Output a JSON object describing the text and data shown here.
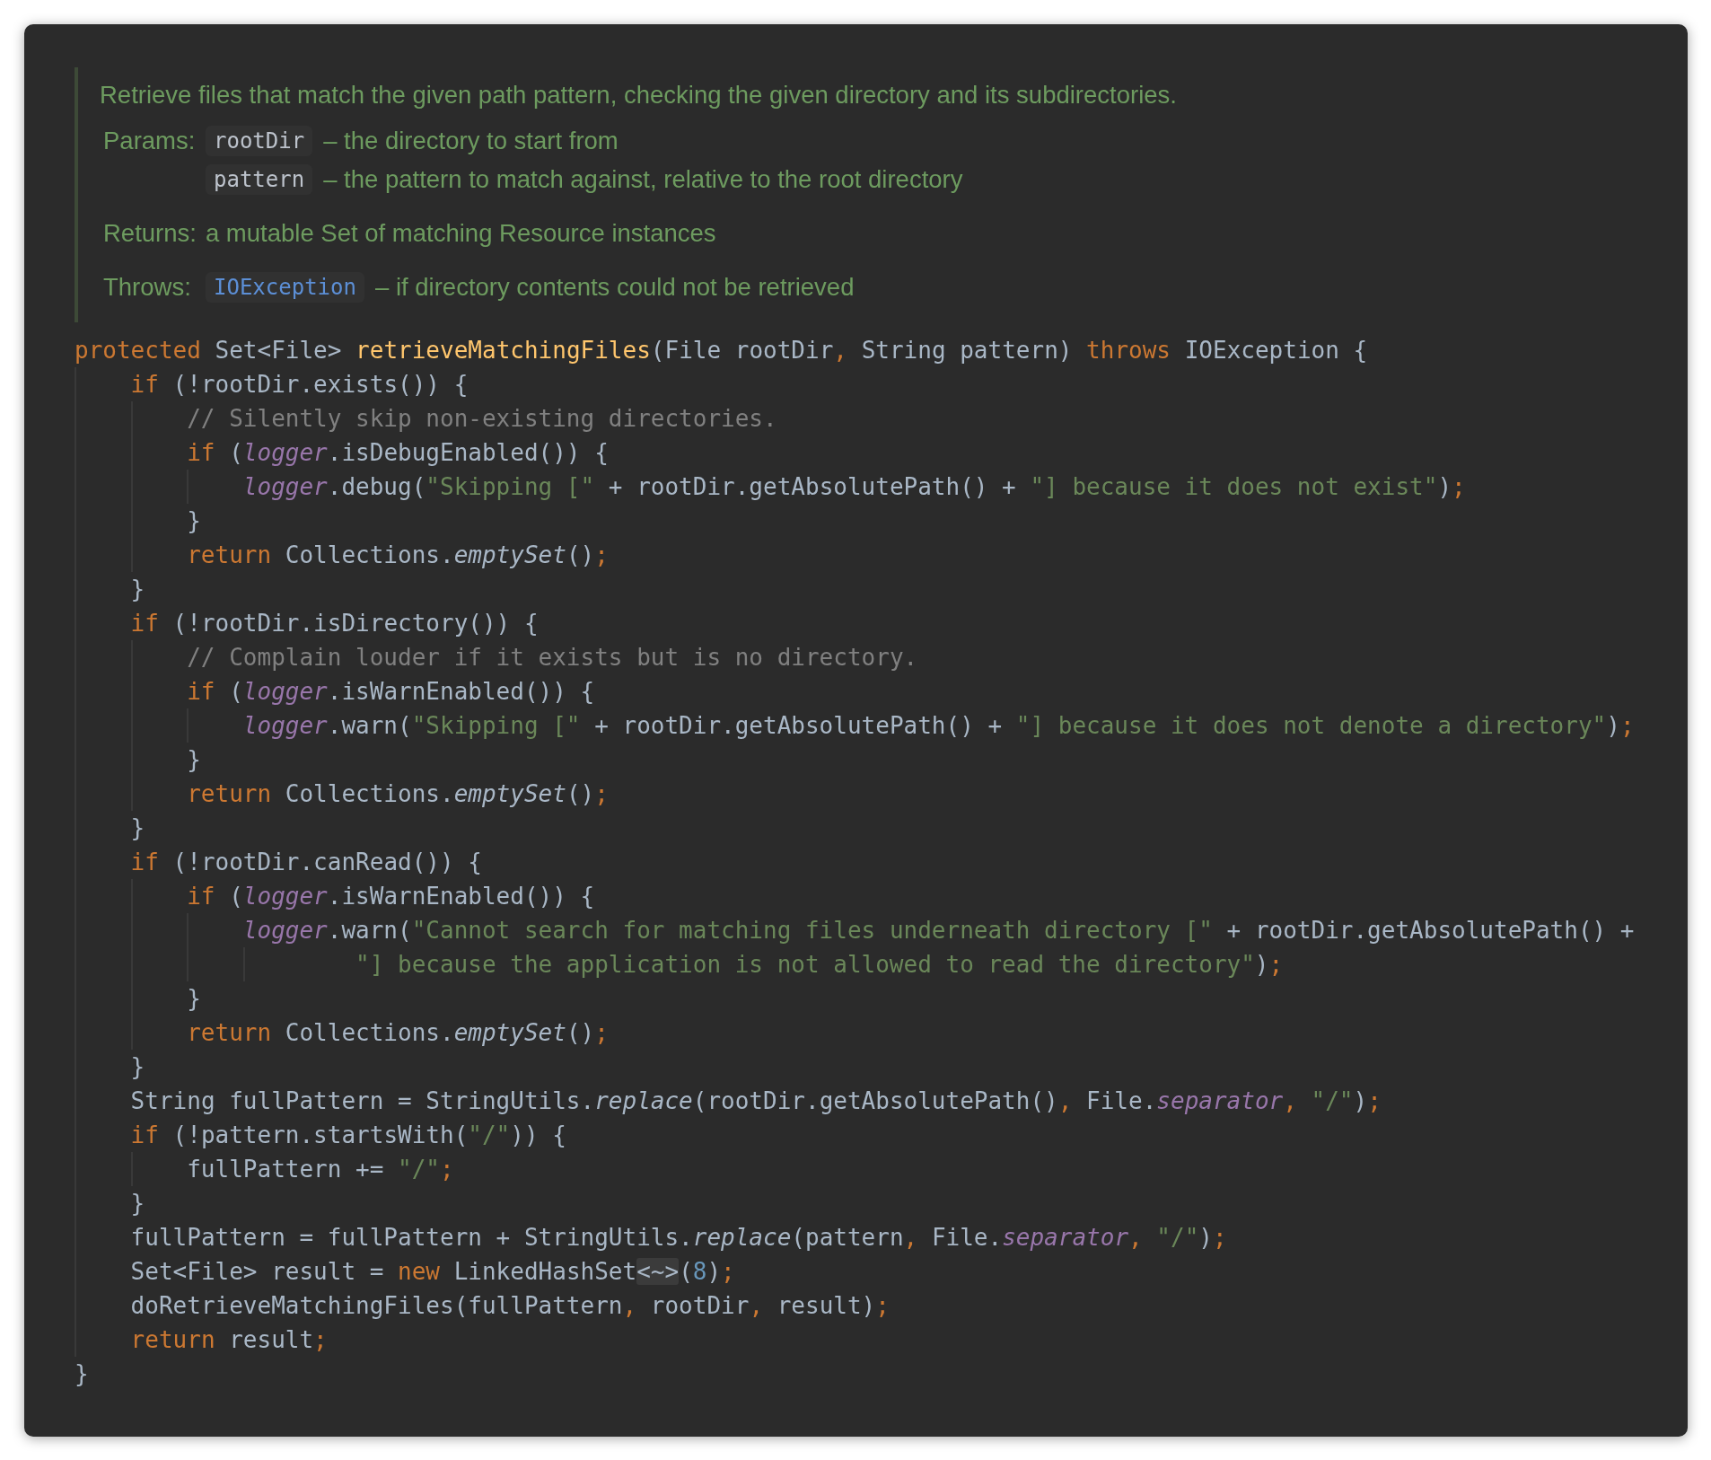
{
  "doc_comment": {
    "summary": "Retrieve files that match the given path pattern, checking the given directory and its subdirectories.",
    "params": {
      "label": "Params:",
      "items": [
        {
          "name": "rootDir",
          "description": "– the directory to start from"
        },
        {
          "name": "pattern",
          "description": "– the pattern to match against, relative to the root directory"
        }
      ]
    },
    "returns": {
      "label": "Returns:",
      "text": "a mutable Set of matching Resource instances"
    },
    "throws": {
      "label": "Throws:",
      "items": [
        {
          "name": "IOException",
          "description": "– if directory contents could not be retrieved"
        }
      ]
    }
  },
  "code": [
    {
      "tokens": [
        {
          "kind": "kw",
          "text": "protected "
        },
        {
          "kind": "plain",
          "text": "Set<File> "
        },
        {
          "kind": "fn",
          "text": "retrieveMatchingFiles"
        },
        {
          "kind": "plain",
          "text": "(File rootDir"
        },
        {
          "kind": "punct",
          "text": ", "
        },
        {
          "kind": "plain",
          "text": "String pattern) "
        },
        {
          "kind": "kw",
          "text": "throws "
        },
        {
          "kind": "plain",
          "text": "IOException {"
        }
      ],
      "children": [
        {
          "tokens": [
            {
              "kind": "kw",
              "text": "if "
            },
            {
              "kind": "plain",
              "text": "(!rootDir.exists()) {"
            }
          ],
          "children": [
            {
              "tokens": [
                {
                  "kind": "comment",
                  "text": "// Silently skip non-existing directories."
                }
              ]
            },
            {
              "tokens": [
                {
                  "kind": "kw",
                  "text": "if "
                },
                {
                  "kind": "plain",
                  "text": "("
                },
                {
                  "kind": "field",
                  "text": "logger"
                },
                {
                  "kind": "plain",
                  "text": ".isDebugEnabled()) {"
                }
              ],
              "children": [
                {
                  "tokens": [
                    {
                      "kind": "field",
                      "text": "logger"
                    },
                    {
                      "kind": "plain",
                      "text": ".debug("
                    },
                    {
                      "kind": "str",
                      "text": "\"Skipping [\""
                    },
                    {
                      "kind": "plain",
                      "text": " + rootDir.getAbsolutePath() + "
                    },
                    {
                      "kind": "str",
                      "text": "\"] because it does not exist\""
                    },
                    {
                      "kind": "plain",
                      "text": ")"
                    },
                    {
                      "kind": "punct",
                      "text": ";"
                    }
                  ]
                }
              ]
            },
            {
              "tokens": [
                {
                  "kind": "plain",
                  "text": "}"
                }
              ]
            },
            {
              "tokens": [
                {
                  "kind": "kw",
                  "text": "return "
                },
                {
                  "kind": "plain",
                  "text": "Collections."
                },
                {
                  "kind": "static",
                  "text": "emptySet"
                },
                {
                  "kind": "plain",
                  "text": "()"
                },
                {
                  "kind": "punct",
                  "text": ";"
                }
              ]
            }
          ]
        },
        {
          "tokens": [
            {
              "kind": "plain",
              "text": "}"
            }
          ]
        },
        {
          "tokens": [
            {
              "kind": "kw",
              "text": "if "
            },
            {
              "kind": "plain",
              "text": "(!rootDir.isDirectory()) {"
            }
          ],
          "children": [
            {
              "tokens": [
                {
                  "kind": "comment",
                  "text": "// Complain louder if it exists but is no directory."
                }
              ]
            },
            {
              "tokens": [
                {
                  "kind": "kw",
                  "text": "if "
                },
                {
                  "kind": "plain",
                  "text": "("
                },
                {
                  "kind": "field",
                  "text": "logger"
                },
                {
                  "kind": "plain",
                  "text": ".isWarnEnabled()) {"
                }
              ],
              "children": [
                {
                  "tokens": [
                    {
                      "kind": "field",
                      "text": "logger"
                    },
                    {
                      "kind": "plain",
                      "text": ".warn("
                    },
                    {
                      "kind": "str",
                      "text": "\"Skipping [\""
                    },
                    {
                      "kind": "plain",
                      "text": " + rootDir.getAbsolutePath() + "
                    },
                    {
                      "kind": "str",
                      "text": "\"] because it does not denote a directory\""
                    },
                    {
                      "kind": "plain",
                      "text": ")"
                    },
                    {
                      "kind": "punct",
                      "text": ";"
                    }
                  ]
                }
              ]
            },
            {
              "tokens": [
                {
                  "kind": "plain",
                  "text": "}"
                }
              ]
            },
            {
              "tokens": [
                {
                  "kind": "kw",
                  "text": "return "
                },
                {
                  "kind": "plain",
                  "text": "Collections."
                },
                {
                  "kind": "static",
                  "text": "emptySet"
                },
                {
                  "kind": "plain",
                  "text": "()"
                },
                {
                  "kind": "punct",
                  "text": ";"
                }
              ]
            }
          ]
        },
        {
          "tokens": [
            {
              "kind": "plain",
              "text": "}"
            }
          ]
        },
        {
          "tokens": [
            {
              "kind": "kw",
              "text": "if "
            },
            {
              "kind": "plain",
              "text": "(!rootDir.canRead()) {"
            }
          ],
          "children": [
            {
              "tokens": [
                {
                  "kind": "kw",
                  "text": "if "
                },
                {
                  "kind": "plain",
                  "text": "("
                },
                {
                  "kind": "field",
                  "text": "logger"
                },
                {
                  "kind": "plain",
                  "text": ".isWarnEnabled()) {"
                }
              ],
              "children": [
                {
                  "tokens": [
                    {
                      "kind": "field",
                      "text": "logger"
                    },
                    {
                      "kind": "plain",
                      "text": ".warn("
                    },
                    {
                      "kind": "str",
                      "text": "\"Cannot search for matching files underneath directory [\""
                    },
                    {
                      "kind": "plain",
                      "text": " + rootDir.getAbsolutePath() +"
                    }
                  ],
                  "continued": [
                    {
                      "kind": "str",
                      "text": "\"] because the application is not allowed to read the directory\""
                    },
                    {
                      "kind": "plain",
                      "text": ")"
                    },
                    {
                      "kind": "punct",
                      "text": ";"
                    }
                  ]
                }
              ]
            },
            {
              "tokens": [
                {
                  "kind": "plain",
                  "text": "}"
                }
              ]
            },
            {
              "tokens": [
                {
                  "kind": "kw",
                  "text": "return "
                },
                {
                  "kind": "plain",
                  "text": "Collections."
                },
                {
                  "kind": "static",
                  "text": "emptySet"
                },
                {
                  "kind": "plain",
                  "text": "()"
                },
                {
                  "kind": "punct",
                  "text": ";"
                }
              ]
            }
          ]
        },
        {
          "tokens": [
            {
              "kind": "plain",
              "text": "}"
            }
          ]
        },
        {
          "tokens": [
            {
              "kind": "plain",
              "text": "String fullPattern = StringUtils."
            },
            {
              "kind": "static",
              "text": "replace"
            },
            {
              "kind": "plain",
              "text": "(rootDir.getAbsolutePath()"
            },
            {
              "kind": "punct",
              "text": ", "
            },
            {
              "kind": "plain",
              "text": "File."
            },
            {
              "kind": "field",
              "text": "separator"
            },
            {
              "kind": "punct",
              "text": ", "
            },
            {
              "kind": "str",
              "text": "\"/\""
            },
            {
              "kind": "plain",
              "text": ")"
            },
            {
              "kind": "punct",
              "text": ";"
            }
          ]
        },
        {
          "tokens": [
            {
              "kind": "kw",
              "text": "if "
            },
            {
              "kind": "plain",
              "text": "(!pattern.startsWith("
            },
            {
              "kind": "str",
              "text": "\"/\""
            },
            {
              "kind": "plain",
              "text": ")) {"
            }
          ],
          "children": [
            {
              "tokens": [
                {
                  "kind": "plain",
                  "text": "fullPattern += "
                },
                {
                  "kind": "str",
                  "text": "\"/\""
                },
                {
                  "kind": "punct",
                  "text": ";"
                }
              ]
            }
          ]
        },
        {
          "tokens": [
            {
              "kind": "plain",
              "text": "}"
            }
          ]
        },
        {
          "tokens": [
            {
              "kind": "plain",
              "text": "fullPattern = fullPattern + StringUtils."
            },
            {
              "kind": "static",
              "text": "replace"
            },
            {
              "kind": "plain",
              "text": "(pattern"
            },
            {
              "kind": "punct",
              "text": ", "
            },
            {
              "kind": "plain",
              "text": "File."
            },
            {
              "kind": "field",
              "text": "separator"
            },
            {
              "kind": "punct",
              "text": ", "
            },
            {
              "kind": "str",
              "text": "\"/\""
            },
            {
              "kind": "plain",
              "text": ")"
            },
            {
              "kind": "punct",
              "text": ";"
            }
          ]
        },
        {
          "tokens": [
            {
              "kind": "plain",
              "text": "Set<File> result = "
            },
            {
              "kind": "kw",
              "text": "new "
            },
            {
              "kind": "plain",
              "text": "LinkedHashSet"
            },
            {
              "kind": "fold",
              "text": "<~>"
            },
            {
              "kind": "plain",
              "text": "("
            },
            {
              "kind": "num",
              "text": "8"
            },
            {
              "kind": "plain",
              "text": ")"
            },
            {
              "kind": "punct",
              "text": ";"
            }
          ]
        },
        {
          "tokens": [
            {
              "kind": "plain",
              "text": "doRetrieveMatchingFiles(fullPattern"
            },
            {
              "kind": "punct",
              "text": ", "
            },
            {
              "kind": "plain",
              "text": "rootDir"
            },
            {
              "kind": "punct",
              "text": ", "
            },
            {
              "kind": "plain",
              "text": "result)"
            },
            {
              "kind": "punct",
              "text": ";"
            }
          ]
        },
        {
          "tokens": [
            {
              "kind": "kw",
              "text": "return "
            },
            {
              "kind": "plain",
              "text": "result"
            },
            {
              "kind": "punct",
              "text": ";"
            }
          ]
        }
      ]
    },
    {
      "tokens": [
        {
          "kind": "plain",
          "text": "}"
        }
      ]
    }
  ]
}
